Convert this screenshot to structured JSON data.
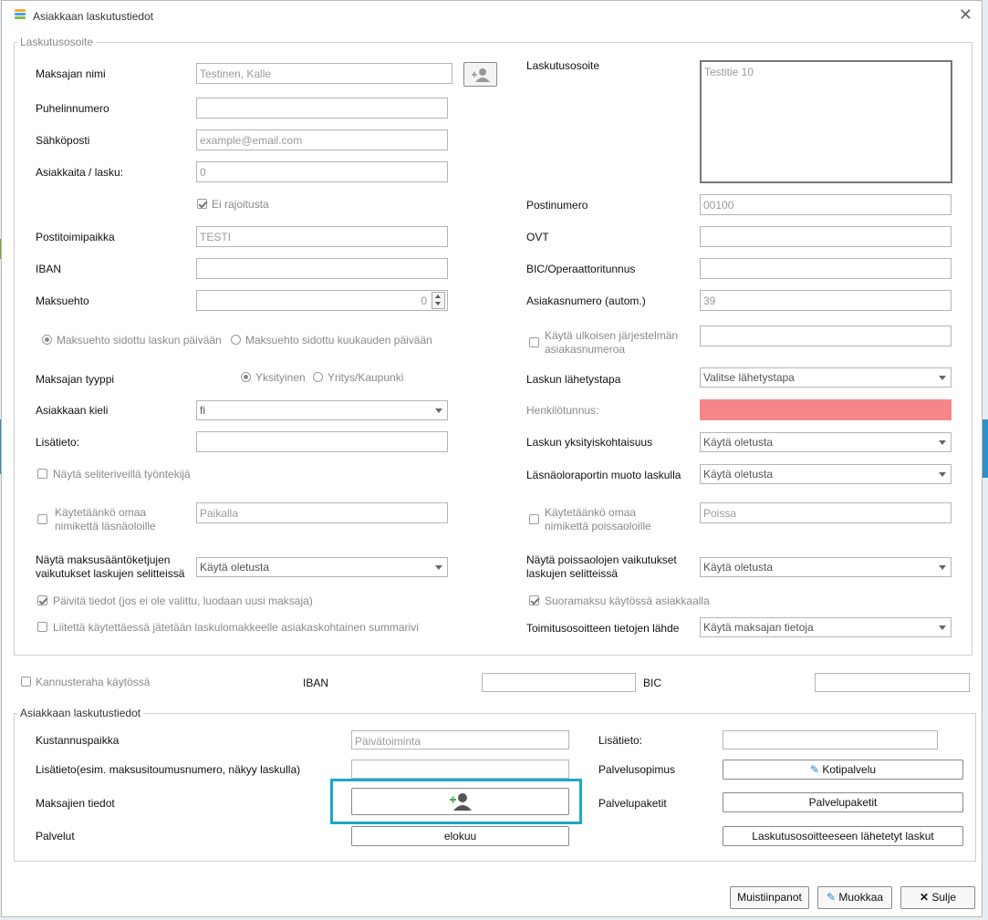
{
  "window": {
    "title": "Asiakkaan laskutustiedot"
  },
  "billing_address": {
    "legend": "Laskutusosoite",
    "left": {
      "payer_name": {
        "label": "Maksajan nimi",
        "value": "Testinen, Kalle"
      },
      "phone": {
        "label": "Puhelinnumero",
        "value": ""
      },
      "email": {
        "label": "Sähköposti",
        "placeholder": "example@email.com"
      },
      "customers_per_invoice": {
        "label": "Asiakkaita / lasku:",
        "value": "0"
      },
      "no_limit": {
        "label": "Ei rajoitusta",
        "checked": true
      },
      "post_office": {
        "label": "Postitoimipaikka",
        "value": "TESTI"
      },
      "iban": {
        "label": "IBAN",
        "value": ""
      },
      "payment_term": {
        "label": "Maksuehto",
        "value": "0"
      },
      "term_day_radio": {
        "label": "Maksuehto sidottu laskun päivään",
        "checked": true
      },
      "term_month_radio": {
        "label": "Maksuehto sidottu kuukauden päivään",
        "checked": false
      },
      "payer_type": {
        "label": "Maksajan tyyppi",
        "private": "Yksityinen",
        "company": "Yritys/Kaupunki"
      },
      "language": {
        "label": "Asiakkaan kieli",
        "value": "fi"
      },
      "extra_info": {
        "label": "Lisätieto:",
        "value": ""
      },
      "show_employee": {
        "label": "Näytä seliteriveillä työntekijä"
      },
      "own_presence_name": {
        "label": "Käytetäänkö omaa nimikettä läsnäoloille",
        "value": "Paikalla"
      },
      "show_rule_effects": {
        "label": "Näytä maksusääntöketjujen vaikutukset laskujen selitteissä",
        "value": "Käytä oletusta"
      },
      "update_info": {
        "label": "Päivitä tiedot (jos ei ole valittu, luodaan uusi maksaja)",
        "checked": true
      },
      "attachment_summary": {
        "label": "Liitettä käytettäessä jätetään laskulomakkeelle asiakaskohtainen summarivi"
      }
    },
    "right": {
      "address": {
        "label": "Laskutusosoite",
        "value": "Testitie 10"
      },
      "postal_code": {
        "label": "Postinumero",
        "value": "00100"
      },
      "ovt": {
        "label": "OVT",
        "value": ""
      },
      "bic": {
        "label": "BIC/Operaattoritunnus",
        "value": ""
      },
      "customer_number": {
        "label": "Asiakasnumero (autom.)",
        "value": "39"
      },
      "external_number": {
        "label": "Käytä ulkoisen järjestelmän asiakasnumeroa",
        "value": ""
      },
      "send_method": {
        "label": "Laskun lähetystapa",
        "value": "Valitse lähetystapa"
      },
      "ssn": {
        "label": "Henkilötunnus:",
        "value": ""
      },
      "privacy": {
        "label": "Laskun yksityiskohtaisuus",
        "value": "Käytä oletusta"
      },
      "attendance_format": {
        "label": "Läsnäoloraportin muoto laskulla",
        "value": "Käytä oletusta"
      },
      "own_absence_name": {
        "label": "Käytetäänkö omaa nimikettä poissaoloille",
        "value": "Poissa"
      },
      "show_absence_effects": {
        "label": "Näytä poissaolojen vaikutukset laskujen selitteissä",
        "value": "Käytä oletusta"
      },
      "direct_debit": {
        "label": "Suoramaksu käytössä asiakkaalla",
        "checked": true
      },
      "delivery_info_source": {
        "label": "Toimitusosoitteen tietojen lähde",
        "value": "Käytä maksajan tietoja"
      }
    }
  },
  "incentive": {
    "label": "Kannusteraha käytössä",
    "iban_label": "IBAN",
    "bic_label": "BIC"
  },
  "customer_billing": {
    "legend": "Asiakkaan laskutustiedot",
    "cost_center": {
      "label": "Kustannuspaikka",
      "placeholder": "Päivätoiminta"
    },
    "extra_info": {
      "label": "Lisätieto:"
    },
    "ref_info": {
      "label": "Lisätieto(esim. maksusitoumusnumero, näkyy laskulla)"
    },
    "service_agreement": {
      "label": "Palvelusopimus",
      "button": "Kotipalvelu"
    },
    "payers": {
      "label": "Maksajien tiedot"
    },
    "service_packages": {
      "label": "Palvelupaketit",
      "button": "Palvelupaketit"
    },
    "services": {
      "label": "Palvelut",
      "button": "elokuu"
    },
    "sent_invoices_button": "Laskutusosoitteeseen lähetetyt laskut"
  },
  "footer": {
    "notes": "Muistiinpanot",
    "edit": "Muokkaa",
    "close": "Sulje"
  },
  "colors": {
    "ssn_highlight": "#f7868b",
    "callout_border": "#1ea7c9"
  }
}
